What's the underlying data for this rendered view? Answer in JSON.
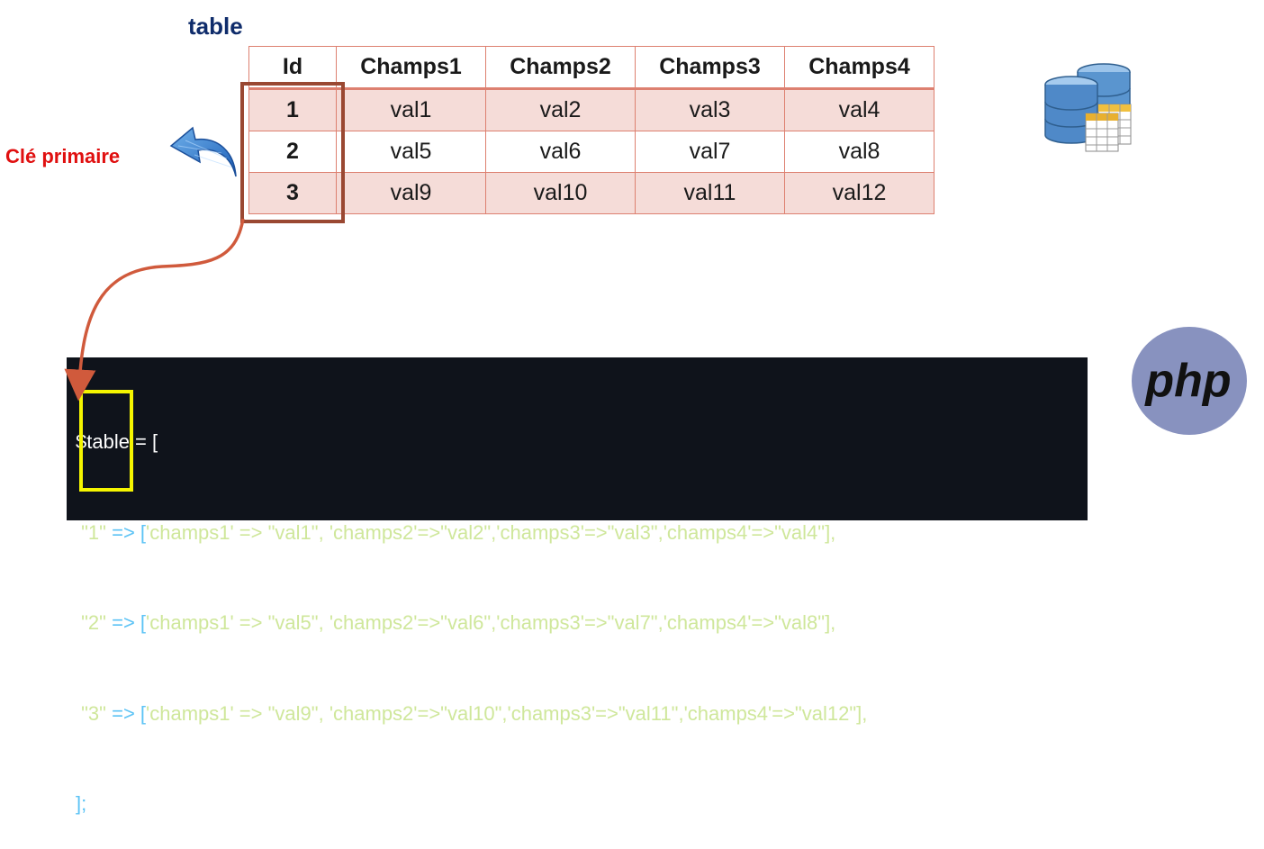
{
  "diagram": {
    "title": "table",
    "primary_key_label": "Clé primaire"
  },
  "table": {
    "headers": [
      "Id",
      "Champs1",
      "Champs2",
      "Champs3",
      "Champs4"
    ],
    "rows": [
      [
        "1",
        "val1",
        "val2",
        "val3",
        "val4"
      ],
      [
        "2",
        "val5",
        "val6",
        "val7",
        "val8"
      ],
      [
        "3",
        "val9",
        "val10",
        "val11",
        "val12"
      ]
    ]
  },
  "code": {
    "open": "$table = [",
    "entries": [
      {
        "key": "\"1\"",
        "arrow": " => [",
        "body": "'champs1' => \"val1\", 'champs2'=>\"val2\",'champs3'=>\"val3\",'champs4'=>\"val4\"],"
      },
      {
        "key": "\"2\"",
        "arrow": " => [",
        "body": "'champs1' => \"val5\", 'champs2'=>\"val6\",'champs3'=>\"val7\",'champs4'=>\"val8\"],"
      },
      {
        "key": "\"3\"",
        "arrow": " => [",
        "body": "'champs1' => \"val9\", 'champs2'=>\"val10\",'champs3'=>\"val11\",'champs4'=>\"val12\"],"
      }
    ],
    "close": "];"
  },
  "logo": {
    "text": "php"
  },
  "icons": {
    "pointer": "curved-arrow-icon",
    "database": "database-icon",
    "logo": "php-logo-icon"
  },
  "colors": {
    "title": "#0f2c6b",
    "primary_key_label": "#e01010",
    "table_border": "#dd8070",
    "row_shade": "#f5dcd8",
    "pk_box": "#9a4832",
    "connector": "#d05a3c",
    "code_background": "#0f131b",
    "code_string": "#cfe79b",
    "code_operator": "#5cc3f5",
    "key_box": "#f5f500",
    "php_logo": "#8892bf"
  }
}
